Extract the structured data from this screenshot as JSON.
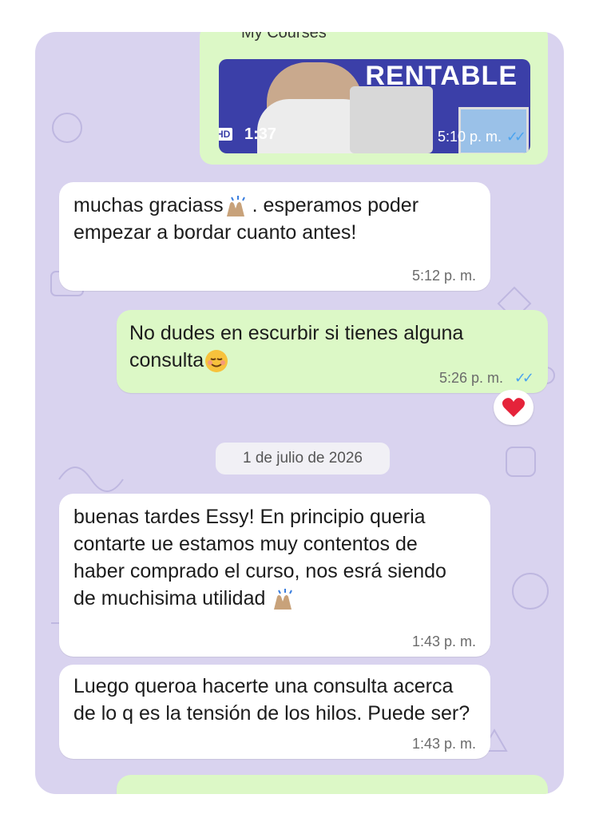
{
  "video_card": {
    "title": "My Courses",
    "banner_text": "RENTABLE",
    "hd_badge": "HD",
    "duration": "1:37",
    "time": "5:10 p. m."
  },
  "messages": [
    {
      "text": "muchas graciass",
      "text2": ". esperamos poder empezar a bordar cuanto antes!",
      "time": "5:12 p. m."
    },
    {
      "text": "No dudes en escurbir si tienes alguna consulta",
      "time": "5:26 p. m."
    },
    {
      "text": "buenas tardes Essy! En principio queria contarte ue estamos muy contentos de haber comprado el curso, nos esrá siendo de muchisima utilidad ",
      "time": "1:43 p. m."
    },
    {
      "text": "Luego queroa hacerte una consulta acerca de lo q es la tensión de los hilos. Puede ser?",
      "time": "1:43 p. m."
    }
  ],
  "date_separator": "1 de julio de 2026",
  "reaction": "heart",
  "colors": {
    "incoming": "#ffffff",
    "outgoing": "#dcf8c6",
    "wallpaper": "#d9d3ef",
    "read_ticks": "#4aa3ef"
  }
}
